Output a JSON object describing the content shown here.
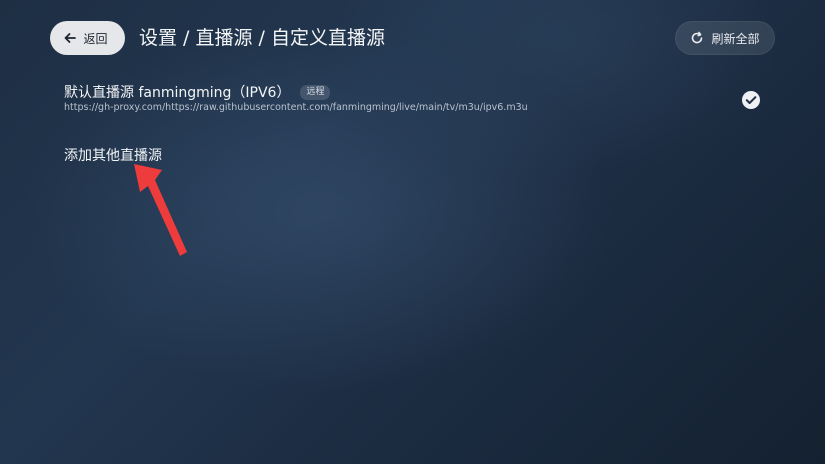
{
  "header": {
    "back_label": "返回",
    "title": "设置 / 直播源 / 自定义直播源",
    "refresh_label": "刷新全部"
  },
  "sources": [
    {
      "name": "默认直播源 fanmingming（IPV6）",
      "badge": "远程",
      "url": "https://gh-proxy.com/https://raw.githubusercontent.com/fanmingming/live/main/tv/m3u/ipv6.m3u",
      "selected": true
    }
  ],
  "add_source_label": "添加其他直播源",
  "icons": {
    "back": "arrow-left-icon",
    "refresh": "refresh-icon",
    "selected": "check-circle-icon",
    "annotation": "red-arrow-icon"
  },
  "colors": {
    "annotation_arrow": "#ee3b3b",
    "background": "#1f3148"
  }
}
